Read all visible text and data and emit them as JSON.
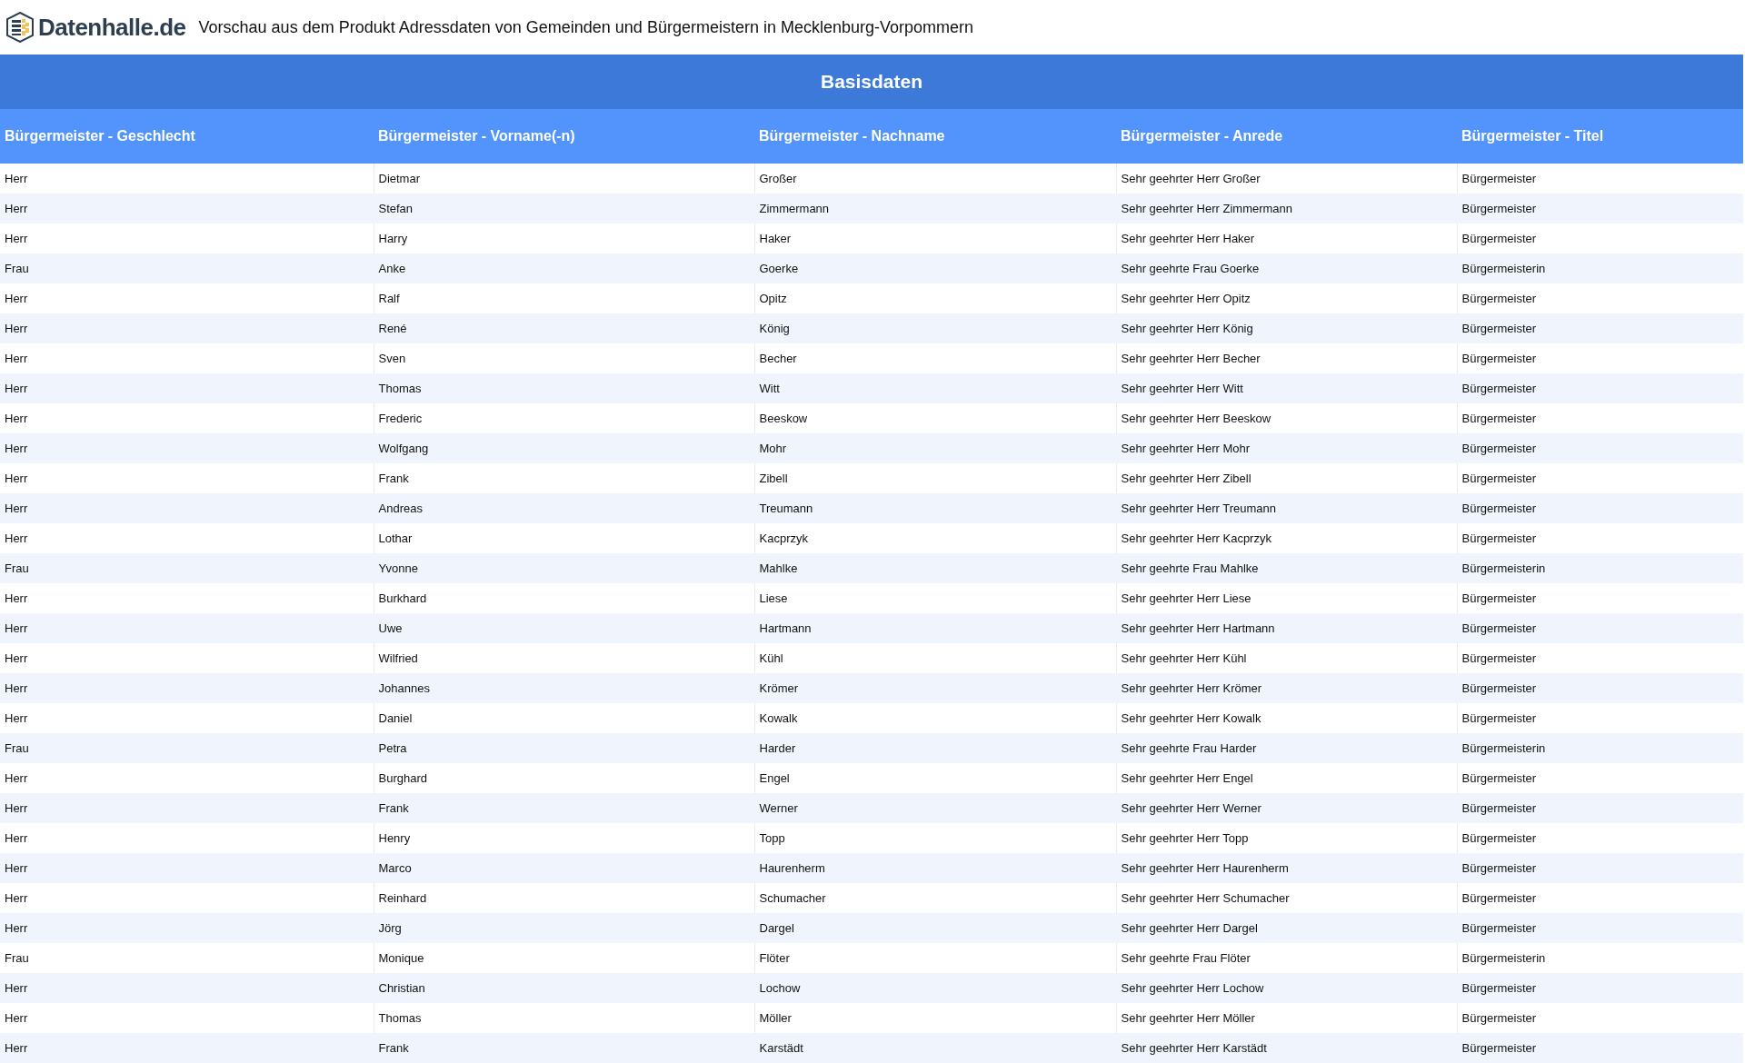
{
  "header": {
    "logo_text": "Datenhalle.de",
    "title": "Vorschau aus dem Produkt Adressdaten von Gemeinden und Bürgermeistern in Mecklenburg-Vorpommern"
  },
  "section_title": "Basisdaten",
  "table": {
    "columns": [
      "Bürgermeister - Geschlecht",
      "Bürgermeister - Vorname(-n)",
      "Bürgermeister - Nachname",
      "Bürgermeister - Anrede",
      "Bürgermeister - Titel"
    ],
    "rows": [
      [
        "Herr",
        "Dietmar",
        "Großer",
        "Sehr geehrter Herr Großer",
        "Bürgermeister"
      ],
      [
        "Herr",
        "Stefan",
        "Zimmermann",
        "Sehr geehrter Herr Zimmermann",
        "Bürgermeister"
      ],
      [
        "Herr",
        "Harry",
        "Haker",
        "Sehr geehrter Herr Haker",
        "Bürgermeister"
      ],
      [
        "Frau",
        "Anke",
        "Goerke",
        "Sehr geehrte Frau Goerke",
        "Bürgermeisterin"
      ],
      [
        "Herr",
        "Ralf",
        "Opitz",
        "Sehr geehrter Herr Opitz",
        "Bürgermeister"
      ],
      [
        "Herr",
        "René",
        "König",
        "Sehr geehrter Herr König",
        "Bürgermeister"
      ],
      [
        "Herr",
        "Sven",
        "Becher",
        "Sehr geehrter Herr Becher",
        "Bürgermeister"
      ],
      [
        "Herr",
        "Thomas",
        "Witt",
        "Sehr geehrter Herr Witt",
        "Bürgermeister"
      ],
      [
        "Herr",
        "Frederic",
        "Beeskow",
        "Sehr geehrter Herr Beeskow",
        "Bürgermeister"
      ],
      [
        "Herr",
        "Wolfgang",
        "Mohr",
        "Sehr geehrter Herr Mohr",
        "Bürgermeister"
      ],
      [
        "Herr",
        "Frank",
        "Zibell",
        "Sehr geehrter Herr Zibell",
        "Bürgermeister"
      ],
      [
        "Herr",
        "Andreas",
        "Treumann",
        "Sehr geehrter Herr Treumann",
        "Bürgermeister"
      ],
      [
        "Herr",
        "Lothar",
        "Kacprzyk",
        "Sehr geehrter Herr Kacprzyk",
        "Bürgermeister"
      ],
      [
        "Frau",
        "Yvonne",
        "Mahlke",
        "Sehr geehrte Frau Mahlke",
        "Bürgermeisterin"
      ],
      [
        "Herr",
        "Burkhard",
        "Liese",
        "Sehr geehrter Herr Liese",
        "Bürgermeister"
      ],
      [
        "Herr",
        "Uwe",
        "Hartmann",
        "Sehr geehrter Herr Hartmann",
        "Bürgermeister"
      ],
      [
        "Herr",
        "Wilfried",
        "Kühl",
        "Sehr geehrter Herr Kühl",
        "Bürgermeister"
      ],
      [
        "Herr",
        "Johannes",
        "Krömer",
        "Sehr geehrter Herr Krömer",
        "Bürgermeister"
      ],
      [
        "Herr",
        "Daniel",
        "Kowalk",
        "Sehr geehrter Herr Kowalk",
        "Bürgermeister"
      ],
      [
        "Frau",
        "Petra",
        "Harder",
        "Sehr geehrte Frau Harder",
        "Bürgermeisterin"
      ],
      [
        "Herr",
        "Burghard",
        "Engel",
        "Sehr geehrter Herr Engel",
        "Bürgermeister"
      ],
      [
        "Herr",
        "Frank",
        "Werner",
        "Sehr geehrter Herr Werner",
        "Bürgermeister"
      ],
      [
        "Herr",
        "Henry",
        "Topp",
        "Sehr geehrter Herr Topp",
        "Bürgermeister"
      ],
      [
        "Herr",
        "Marco",
        "Haurenherm",
        "Sehr geehrter Herr Haurenherm",
        "Bürgermeister"
      ],
      [
        "Herr",
        "Reinhard",
        "Schumacher",
        "Sehr geehrter Herr Schumacher",
        "Bürgermeister"
      ],
      [
        "Herr",
        "Jörg",
        "Dargel",
        "Sehr geehrter Herr Dargel",
        "Bürgermeister"
      ],
      [
        "Frau",
        "Monique",
        "Flöter",
        "Sehr geehrte Frau Flöter",
        "Bürgermeisterin"
      ],
      [
        "Herr",
        "Christian",
        "Lochow",
        "Sehr geehrter Herr Lochow",
        "Bürgermeister"
      ],
      [
        "Herr",
        "Thomas",
        "Möller",
        "Sehr geehrter Herr Möller",
        "Bürgermeister"
      ],
      [
        "Herr",
        "Frank",
        "Karstädt",
        "Sehr geehrter Herr Karstädt",
        "Bürgermeister"
      ]
    ]
  }
}
